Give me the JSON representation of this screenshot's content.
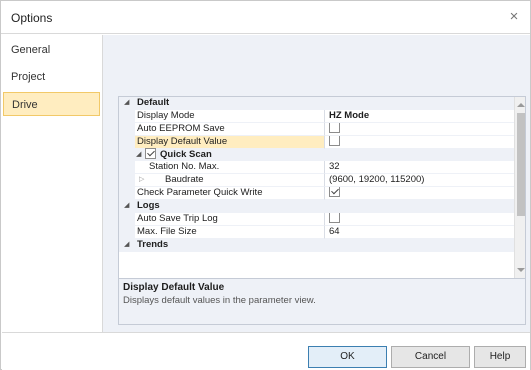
{
  "window": {
    "title": "Options",
    "close_glyph": "×"
  },
  "nav": {
    "items": [
      {
        "label": "General"
      },
      {
        "label": "Project"
      },
      {
        "label": "Drive"
      }
    ]
  },
  "grid": {
    "rows": [
      {
        "kind": "category",
        "name": "Default"
      },
      {
        "kind": "prop",
        "name": "Display Mode",
        "value": "HZ Mode"
      },
      {
        "kind": "prop",
        "name": "Auto EEPROM Save",
        "checkbox": false
      },
      {
        "kind": "prop",
        "name": "Display Default Value",
        "checkbox": false,
        "selected": true
      },
      {
        "kind": "subcategory",
        "name": "Quick Scan",
        "checkbox": true
      },
      {
        "kind": "prop",
        "name": "Station No. Max.",
        "value": "32"
      },
      {
        "kind": "prop",
        "name": "Baudrate",
        "value": "(9600, 19200, 115200)"
      },
      {
        "kind": "prop",
        "name": "Check Parameter Quick Write",
        "checkbox": true
      },
      {
        "kind": "category",
        "name": "Logs"
      },
      {
        "kind": "prop",
        "name": "Auto Save Trip Log",
        "checkbox": false
      },
      {
        "kind": "prop",
        "name": "Max. File Size",
        "value": "64"
      },
      {
        "kind": "category",
        "name": "Trends"
      }
    ]
  },
  "description": {
    "title": "Display Default Value",
    "text": "Displays default values in the parameter view."
  },
  "buttons": {
    "ok": "OK",
    "cancel": "Cancel",
    "help": "Help"
  },
  "icons": {
    "expanded": "◢",
    "collapsed": "▷"
  },
  "colors": {
    "selection": "#ffedc0",
    "selection_border": "#f2c968",
    "panel_bg": "#eef1f7"
  }
}
